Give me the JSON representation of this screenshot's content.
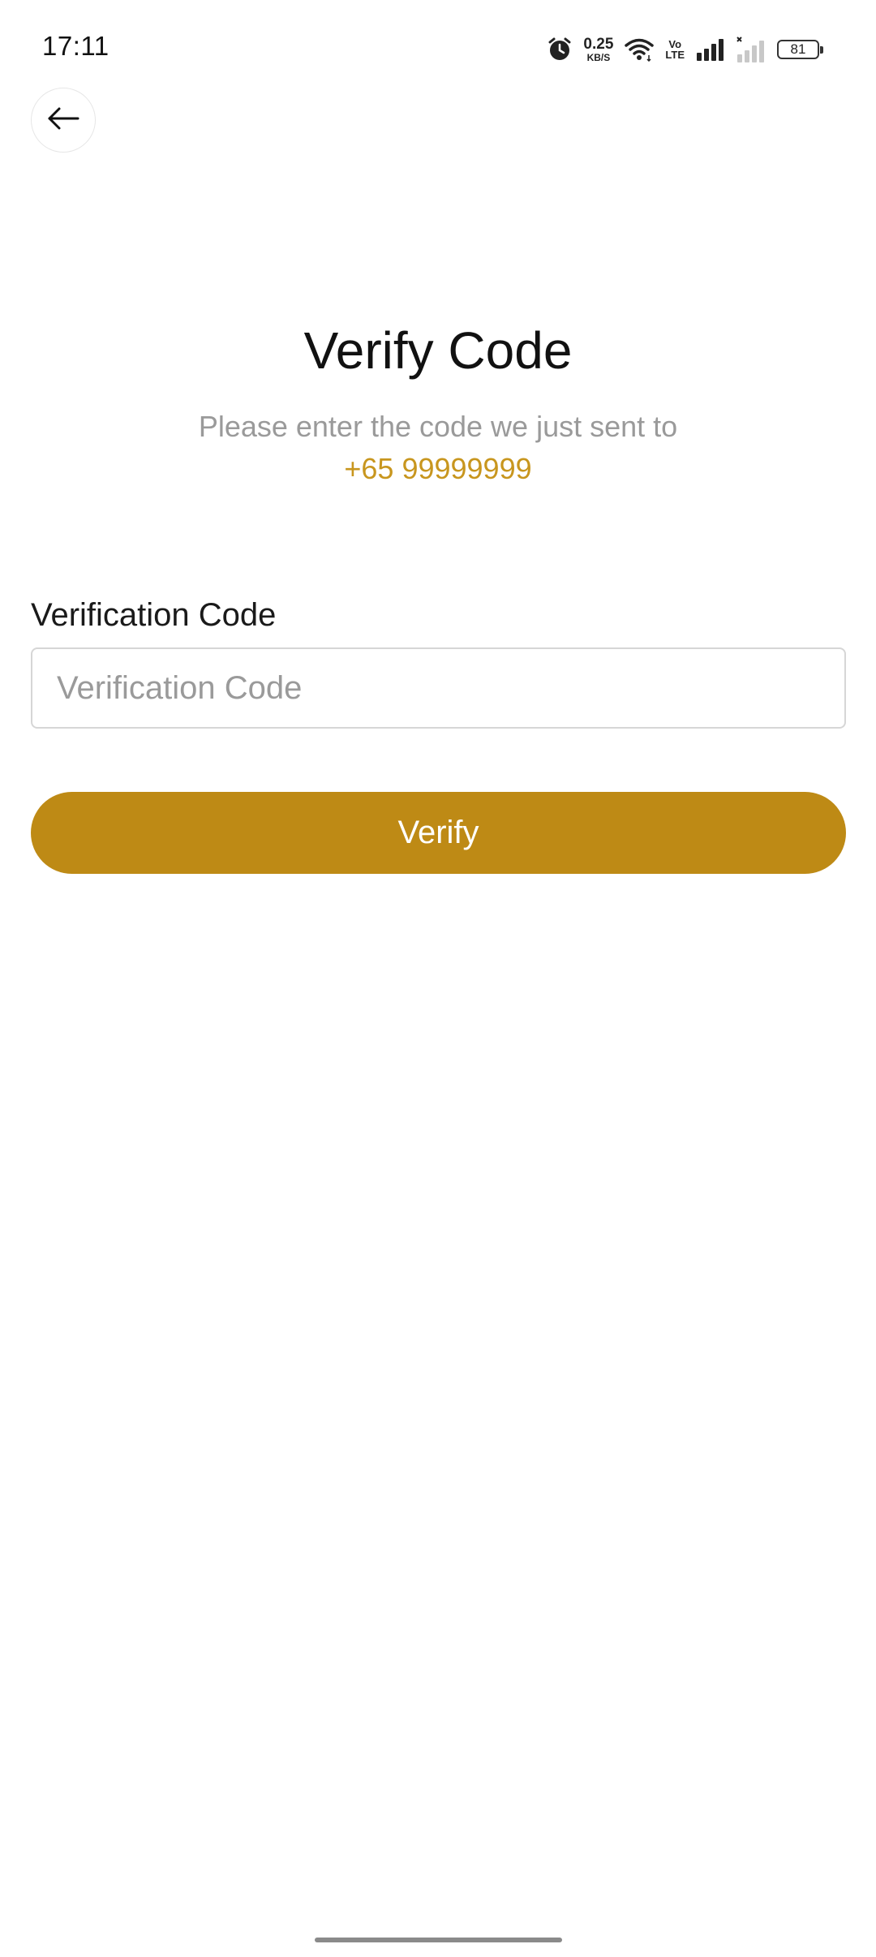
{
  "status_bar": {
    "time": "17:11",
    "net_speed_value": "0.25",
    "net_speed_unit": "KB/S",
    "volte_top": "Vo",
    "volte_bottom": "LTE",
    "battery_level": "81",
    "icons": [
      "alarm-icon",
      "wifi-icon",
      "volte-icon",
      "signal-icon",
      "signal-no-service-icon",
      "battery-icon"
    ]
  },
  "header": {
    "title": "Verify Code",
    "subtitle": "Please enter the code we just sent to",
    "phone": "+65 99999999"
  },
  "form": {
    "field_label": "Verification Code",
    "field_placeholder": "Verification Code",
    "field_value": "",
    "submit_label": "Verify"
  },
  "colors": {
    "accent": "#be8a15",
    "phone_text": "#c8961e",
    "muted_text": "#9a9a9a"
  }
}
